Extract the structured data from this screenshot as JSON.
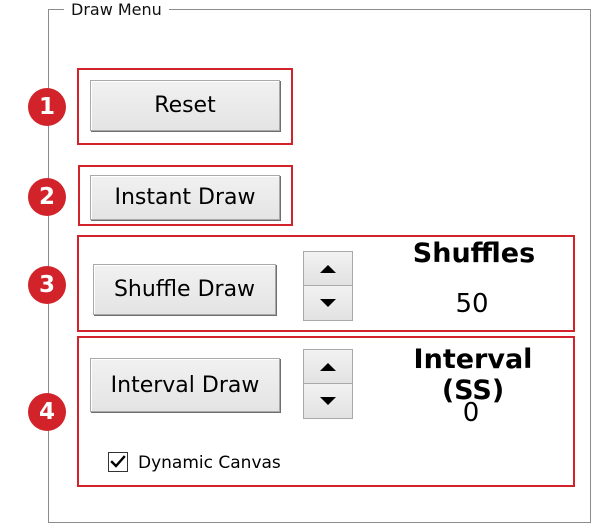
{
  "group": {
    "title": "Draw Menu"
  },
  "markers": [
    "1",
    "2",
    "3",
    "4"
  ],
  "buttons": {
    "reset": "Reset",
    "instant_draw": "Instant Draw",
    "shuffle_draw": "Shuffle Draw",
    "interval_draw": "Interval Draw"
  },
  "shuffles": {
    "label": "Shuffles",
    "value": "50"
  },
  "interval": {
    "label": "Interval (SS)",
    "value": "0"
  },
  "dynamic_canvas": {
    "label": "Dynamic Canvas",
    "checked": true
  },
  "icons": {
    "spin_up": "triangle-up-icon",
    "spin_down": "triangle-down-icon",
    "check": "checkmark-icon"
  },
  "colors": {
    "callout": "#d2232a",
    "marker": "#d2232a"
  }
}
